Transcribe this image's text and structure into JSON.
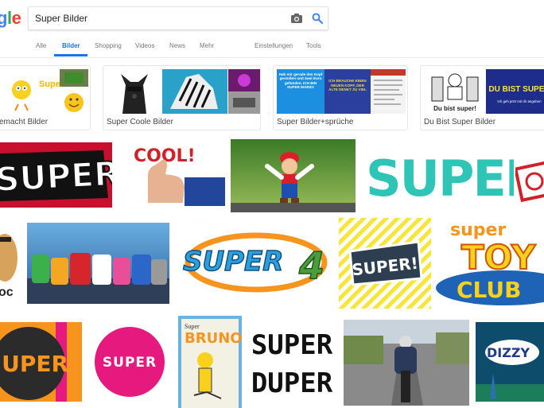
{
  "logo": {
    "letters": [
      "g",
      "l",
      "e"
    ]
  },
  "search": {
    "value": "Super Bilder"
  },
  "tabs": [
    {
      "label": "Alle"
    },
    {
      "label": "Bilder",
      "active": true
    },
    {
      "label": "Shopping"
    },
    {
      "label": "Videos"
    },
    {
      "label": "News"
    },
    {
      "label": "Mehr"
    },
    {
      "label": "Einstellungen"
    },
    {
      "label": "Tools"
    }
  ],
  "related": [
    {
      "label": "emacht Bilder"
    },
    {
      "label": "Super Coole Bilder"
    },
    {
      "label": "Super Bilder+sprüche"
    },
    {
      "label": "Du Bist Super Bilder"
    }
  ],
  "thumb_text": {
    "super_small": "Super",
    "spruch_a": "Hab mir gerade den Kopf gestoßen und zwei Euro gefunden. ICH BIN SUPER MARIO!",
    "spruch_b": "ICH BRAUCHE EINEN NEUEN KOPF, DER ALTE DENKT ZU VIEL",
    "du_bist_super": "Du bist super!",
    "du_bist_super_caps": "DU BIST SUPER",
    "du_bist_sub": "Ich geh jetzt mit dir angeben"
  },
  "images": {
    "super_red": "SUPER",
    "cool": "COOL!",
    "super_colorful": "SUPER",
    "super4": "SUPER",
    "super4_num": "4",
    "super_badge": "SUPER!",
    "toy_super": "super",
    "toy_toy": "TOY",
    "toy_club": "CLUB",
    "dark_super": "SUPER",
    "pink_super": "SUPER",
    "bruno_top": "Super",
    "bruno": "BRUNO",
    "duper_1": "SUPER",
    "duper_2": "DUPER",
    "dizzy": "DIZZY",
    "cropped_left": "oc"
  },
  "colors": {
    "accent": "#1a73e8",
    "red": "#c8102e",
    "pink": "#e6197f",
    "yellow": "#f7e53b",
    "orange": "#f7941d"
  }
}
